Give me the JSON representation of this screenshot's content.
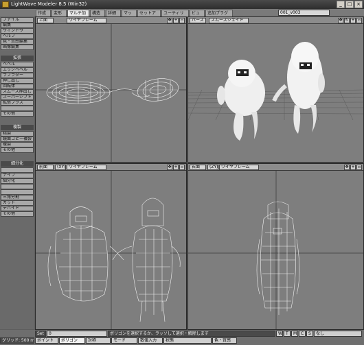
{
  "window": {
    "title": "LightWave Modeler 8.5 (Win32)"
  },
  "tabs": [
    "作成",
    "変形",
    "マルチ加工",
    "構造",
    "詳細",
    "マップ",
    "セットアップ",
    "ユーティリティ",
    "ビュー",
    "追加プラグイン"
  ],
  "active_tab": "マルチ加工",
  "layer_selector": "001_v003",
  "sidebar": {
    "top_items": [
      "ファイル",
      "編集",
      "ウィンドウ",
      "ヘルプ",
      "色・質感編集",
      "画像編集"
    ],
    "sections": [
      {
        "header": "拡張",
        "items": [
          "ベベル",
          "エッジベベル",
          "ラブラター",
          "押し出し",
          "回転体",
          "スムース押出し",
          "スーパーシフト",
          "拡張プラス",
          "",
          "その他"
        ]
      },
      {
        "header": "複製",
        "items": [
          "精製",
          "鏡面コピー複製",
          "複製",
          "その他"
        ]
      },
      {
        "header": "細分化",
        "items": [
          "",
          "ナイフ",
          "細分化",
          "",
          "",
          "三角分割",
          "カット",
          "デバイド",
          "その他"
        ]
      }
    ]
  },
  "viewports": {
    "top": {
      "view": "上面",
      "mode": "ワイヤフレーム"
    },
    "perspective": {
      "view": "パース",
      "mode": "スムースシェイド"
    },
    "front": {
      "view": "前面",
      "axis": "(XY)",
      "mode": "ワイヤフレーム"
    },
    "right": {
      "view": "右面",
      "axis": "(ZY)",
      "mode": "ワイヤフレーム"
    }
  },
  "statusbar": {
    "set_label": "Set",
    "set_value": "0",
    "message": "ポリゴンを選択するか、ラッソして選択・解除します",
    "grid": "グリッド: 500 mm",
    "modes": [
      "ポイント",
      "ポリゴン",
      "対称",
      "モード",
      "数値入力",
      "状態",
      "色・質感",
      "なし"
    ],
    "active_mode": "ポリゴン",
    "buttons": [
      "W",
      "T",
      "M",
      "C",
      "S"
    ]
  }
}
